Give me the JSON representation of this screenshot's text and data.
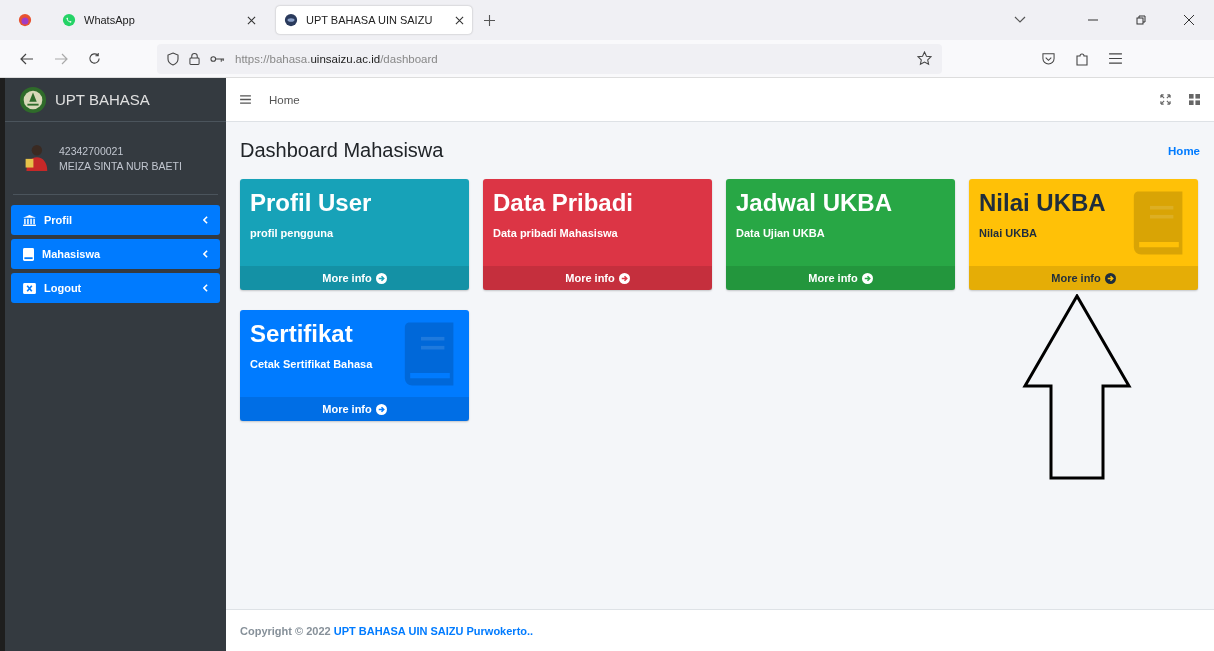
{
  "browser": {
    "tabs": [
      {
        "title": "WhatsApp",
        "selected": false,
        "kind": "whatsapp"
      },
      {
        "title": "UPT BAHASA UIN SAIZU",
        "selected": true,
        "kind": "site"
      }
    ],
    "address": {
      "prefix": "https://bahasa.",
      "domain": "uinsaizu.ac.id",
      "path": "/dashboard"
    }
  },
  "sidebar": {
    "brand": "UPT BAHASA",
    "user": {
      "id": "42342700021",
      "name": "MEIZA SINTA NUR BAETI"
    },
    "items": [
      {
        "label": "Profil",
        "kind": "bank"
      },
      {
        "label": "Mahasiswa",
        "kind": "book"
      },
      {
        "label": "Logout",
        "kind": "close"
      }
    ]
  },
  "header": {
    "nav_link": "Home"
  },
  "page": {
    "title": "Dashboard Mahasiswa",
    "breadcrumb": "Home"
  },
  "cards": [
    {
      "title": "Profil User",
      "subtitle": "profil pengguna",
      "footer": "More info",
      "color": "#17a2b8",
      "dark_text": false,
      "has_icon": false
    },
    {
      "title": "Data Pribadi",
      "subtitle": "Data pribadi Mahasiswa",
      "footer": "More info",
      "color": "#dc3545",
      "dark_text": false,
      "has_icon": false
    },
    {
      "title": "Jadwal UKBA",
      "subtitle": "Data Ujian UKBA",
      "footer": "More info",
      "color": "#28a745",
      "dark_text": false,
      "has_icon": false
    },
    {
      "title": "Nilai UKBA",
      "subtitle": "Nilai UKBA",
      "footer": "More info",
      "color": "#ffc107",
      "dark_text": true,
      "has_icon": true
    },
    {
      "title": "Sertifikat",
      "subtitle": "Cetak Sertifikat Bahasa",
      "footer": "More info",
      "color": "#007bff",
      "dark_text": false,
      "has_icon": true
    }
  ],
  "annotation": {
    "kind": "arrow-up"
  },
  "footer": {
    "text": "Copyright © 2022 ",
    "link": "UPT BAHASA UIN SAIZU Purwokerto.."
  }
}
